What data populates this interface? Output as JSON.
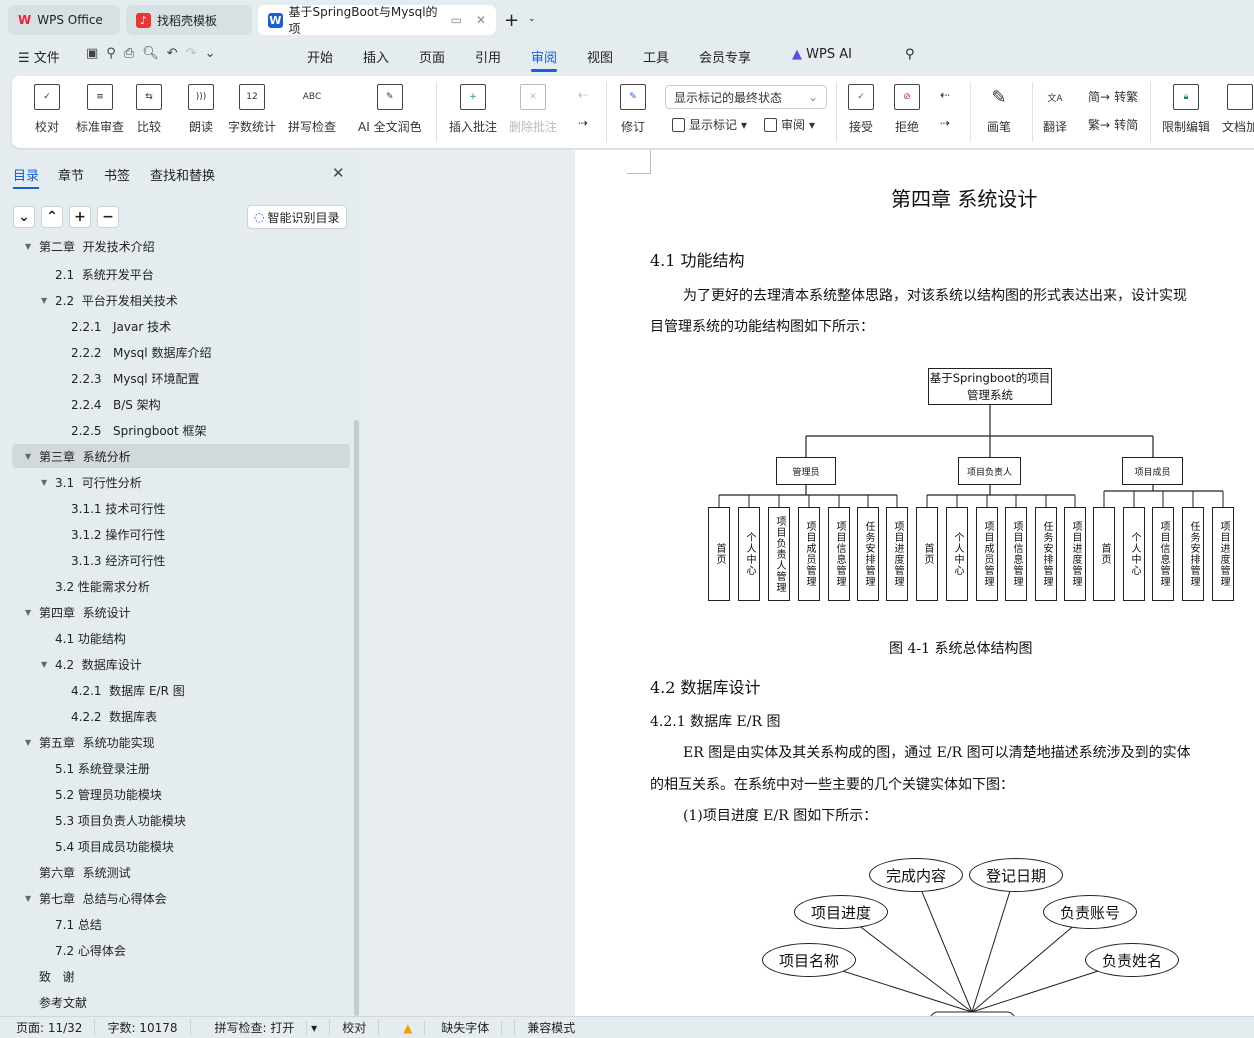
{
  "tabs": [
    {
      "label": "WPS Office",
      "icon": "wps-icon"
    },
    {
      "label": "找稻壳模板",
      "icon": "docer-icon"
    },
    {
      "label": "基于SpringBoot与Mysql的项",
      "icon": "word-doc-icon"
    }
  ],
  "menu": {
    "file": "文件",
    "items": [
      "开始",
      "插入",
      "页面",
      "引用",
      "审阅",
      "视图",
      "工具",
      "会员专享"
    ],
    "active": "审阅",
    "ai": "WPS AI"
  },
  "ribbon": {
    "proofread": "校对",
    "standard_review": "标准审查",
    "compare": "比较",
    "read_aloud": "朗读",
    "word_count": "字数统计",
    "spell_check": "拼写检查",
    "ai_polish": "AI 全文润色",
    "insert_comment": "插入批注",
    "delete_comment": "删除批注",
    "track_changes": "修订",
    "markup_mode": "显示标记的最终状态",
    "show_markup": "显示标记",
    "review_pane": "审阅",
    "accept": "接受",
    "reject": "拒绝",
    "pen": "画笔",
    "translate": "翻译",
    "to_traditional": "转繁",
    "to_simplified": "转简",
    "restrict_edit": "限制编辑",
    "doc_encrypt": "文档加"
  },
  "sidebar": {
    "tabs": [
      "目录",
      "章节",
      "书签",
      "查找和替换"
    ],
    "active_tab": "目录",
    "smart_toc": "智能识别目录",
    "toc": [
      {
        "label": "第二章  开发技术介绍",
        "level": 0,
        "arrow": true
      },
      {
        "label": "2.1  系统开发平台",
        "level": 1
      },
      {
        "label": "2.2  平台开发相关技术",
        "level": 1,
        "arrow": true
      },
      {
        "label": "2.2.1   Javar 技术",
        "level": 2
      },
      {
        "label": "2.2.2   Mysql 数据库介绍",
        "level": 2
      },
      {
        "label": "2.2.3   Mysql 环境配置",
        "level": 2
      },
      {
        "label": "2.2.4   B/S 架构",
        "level": 2
      },
      {
        "label": "2.2.5   Springboot 框架",
        "level": 2
      },
      {
        "label": "第三章  系统分析",
        "level": 0,
        "arrow": true,
        "selected": true
      },
      {
        "label": "3.1  可行性分析",
        "level": 1,
        "arrow": true
      },
      {
        "label": "3.1.1 技术可行性",
        "level": 2
      },
      {
        "label": "3.1.2 操作可行性",
        "level": 2
      },
      {
        "label": "3.1.3 经济可行性",
        "level": 2
      },
      {
        "label": "3.2 性能需求分析",
        "level": 1
      },
      {
        "label": "第四章  系统设计",
        "level": 0,
        "arrow": true
      },
      {
        "label": "4.1 功能结构",
        "level": 1
      },
      {
        "label": "4.2  数据库设计",
        "level": 1,
        "arrow": true
      },
      {
        "label": "4.2.1  数据库 E/R 图",
        "level": 2
      },
      {
        "label": "4.2.2  数据库表",
        "level": 2
      },
      {
        "label": "第五章  系统功能实现",
        "level": 0,
        "arrow": true
      },
      {
        "label": "5.1 系统登录注册",
        "level": 1
      },
      {
        "label": "5.2 管理员功能模块",
        "level": 1
      },
      {
        "label": "5.3 项目负责人功能模块",
        "level": 1
      },
      {
        "label": "5.4 项目成员功能模块",
        "level": 1
      },
      {
        "label": "第六章  系统测试",
        "level": 0
      },
      {
        "label": "第七章  总结与心得体会",
        "level": 0,
        "arrow": true
      },
      {
        "label": "7.1 总结",
        "level": 1
      },
      {
        "label": "7.2 心得体会",
        "level": 1
      },
      {
        "label": "致   谢",
        "level": 0
      },
      {
        "label": "参考文献",
        "level": 0
      }
    ]
  },
  "doc": {
    "chapter_title": "第四章  系统设计",
    "h41": "4.1 功能结构",
    "p1a": "为了更好的去理清本系统整体思路，对该系统以结构图的形式表达出来，设计实现",
    "p1b": "目管理系统的功能结构图如下所示：",
    "diagram": {
      "root": "基于Springboot的项目管理系统",
      "roles": [
        "管理员",
        "项目负责人",
        "项目成员"
      ],
      "leaves": [
        [
          "首页",
          "个人中心",
          "项目负责人管理",
          "项目成员管理",
          "项目信息管理",
          "任务安排管理",
          "项目进度管理"
        ],
        [
          "首页",
          "个人中心",
          "项目成员管理",
          "项目信息管理",
          "任务安排管理",
          "项目进度管理"
        ],
        [
          "首页",
          "个人中心",
          "项目信息管理",
          "任务安排管理",
          "项目进度管理"
        ]
      ]
    },
    "fig_caption": "图 4-1  系统总体结构图",
    "h42": "4.2  数据库设计",
    "h421": "4.2.1  数据库 E/R 图",
    "p2a": "ER 图是由实体及其关系构成的图，通过 E/R 图可以清楚地描述系统涉及到的实体",
    "p2b": "的相互关系。在系统中对一些主要的几个关键实体如下图：",
    "p3": "(1)项目进度 E/R 图如下所示：",
    "er_attrs": [
      "完成内容",
      "登记日期",
      "项目进度",
      "负责账号",
      "项目名称",
      "负责姓名"
    ]
  },
  "status": {
    "page": "页面: 11/32",
    "words": "字数: 10178",
    "spell": "拼写检查: 打开",
    "proof": "校对",
    "missing_font": "缺失字体",
    "compat": "兼容模式"
  }
}
